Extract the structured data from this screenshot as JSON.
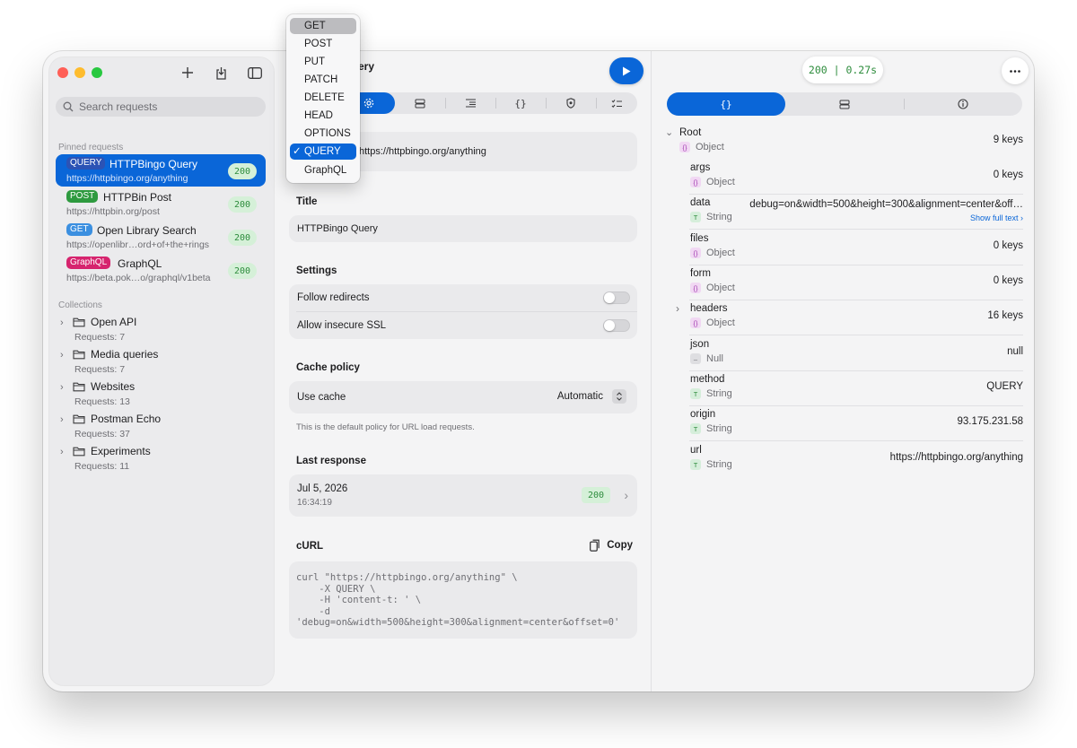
{
  "sidebar": {
    "search_placeholder": "Search requests",
    "pinned_label": "Pinned requests",
    "pinned": [
      {
        "method": "QUERY",
        "method_color": "#2c53b5",
        "name": "HTTPBingo Query",
        "url": "https://httpbingo.org/anything",
        "status": "200",
        "selected": true
      },
      {
        "method": "POST",
        "method_color": "#2e9a3f",
        "name": "HTTPBin Post",
        "url": "https://httpbin.org/post",
        "status": "200"
      },
      {
        "method": "GET",
        "method_color": "#3b8fe0",
        "name": "Open Library Search",
        "url": "https://openlibr…ord+of+the+rings",
        "status": "200"
      },
      {
        "method": "GraphQL",
        "method_color": "#d6246e",
        "name": "GraphQL",
        "url": "https://beta.pok…o/graphql/v1beta",
        "status": "200"
      }
    ],
    "collections_label": "Collections",
    "collections": [
      {
        "name": "Open API",
        "count": "Requests: 7"
      },
      {
        "name": "Media queries",
        "count": "Requests: 7"
      },
      {
        "name": "Websites",
        "count": "Requests: 13"
      },
      {
        "name": "Postman Echo",
        "count": "Requests: 37"
      },
      {
        "name": "Experiments",
        "count": "Requests: 11"
      }
    ]
  },
  "editor": {
    "header_title": "ery",
    "url_value": "https://httpbingo.org/anything",
    "title_label": "Title",
    "title_value": "HTTPBingo Query",
    "settings_label": "Settings",
    "follow_redirects": "Follow redirects",
    "allow_insecure": "Allow insecure SSL",
    "cache_label": "Cache policy",
    "use_cache": "Use cache",
    "cache_value": "Automatic",
    "cache_note": "This is the default policy for URL load requests.",
    "last_response_label": "Last response",
    "last_response_date": "Jul 5, 2026",
    "last_response_time": "16:34:19",
    "last_response_status": "200",
    "curl_label": "cURL",
    "copy_label": "Copy",
    "curl_text": "curl \"https://httpbingo.org/anything\" \\\n    -X QUERY \\\n    -H 'content-t: ' \\\n    -d\n'debug=on&width=500&height=300&alignment=center&offset=0'"
  },
  "method_menu": {
    "items": [
      "GET",
      "POST",
      "PUT",
      "PATCH",
      "DELETE",
      "HEAD",
      "OPTIONS",
      "QUERY",
      "GraphQL"
    ],
    "checked": "QUERY",
    "hovered": "GET"
  },
  "response": {
    "status_pill": "200 | 0.27s",
    "tree": [
      {
        "key": "Root",
        "type": "Object",
        "value": "9 keys",
        "level": 0,
        "expanded": true
      },
      {
        "key": "args",
        "type": "Object",
        "value": "0 keys",
        "level": 1
      },
      {
        "key": "data",
        "type": "String",
        "value": "debug=on&width=500&height=300&alignment=center&off…",
        "level": 1,
        "link": "Show full text"
      },
      {
        "key": "files",
        "type": "Object",
        "value": "0 keys",
        "level": 1
      },
      {
        "key": "form",
        "type": "Object",
        "value": "0 keys",
        "level": 1
      },
      {
        "key": "headers",
        "type": "Object",
        "value": "16 keys",
        "level": 1,
        "collapsed": true
      },
      {
        "key": "json",
        "type": "Null",
        "value": "null",
        "level": 1
      },
      {
        "key": "method",
        "type": "String",
        "value": "QUERY",
        "level": 1
      },
      {
        "key": "origin",
        "type": "String",
        "value": "93.175.231.58",
        "level": 1
      },
      {
        "key": "url",
        "type": "String",
        "value": "https://httpbingo.org/anything",
        "level": 1
      }
    ]
  }
}
